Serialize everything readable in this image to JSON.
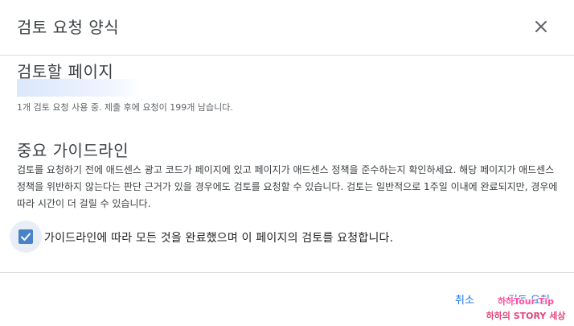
{
  "dialog": {
    "title": "검토 요청 양식",
    "close_icon": "close-icon"
  },
  "page_section": {
    "title": "검토할 페이지",
    "usage_text": "1개 검토 요청 사용 중. 제출 후에 요청이 199개 남습니다."
  },
  "guidelines": {
    "title": "중요 가이드라인",
    "body": "검토를 요청하기 전에 애드센스 광고 코드가 페이지에 있고 페이지가 애드센스 정책을 준수하는지 확인하세요. 해당 페이지가 애드센스 정책을 위반하지 않는다는 판단 근거가 있을 경우에도 검토를 요청할 수 있습니다. 검토는 일반적으로 1주일 이내에 완료되지만, 경우에 따라 시간이 더 걸릴 수 있습니다."
  },
  "confirm_checkbox": {
    "checked": true,
    "label": "가이드라인에 따라 모든 것을 완료했으며 이 페이지의 검토를 요청합니다."
  },
  "footer": {
    "cancel_label": "취소",
    "submit_label": "검토 요청"
  },
  "watermark": {
    "line1": "하하Tour Tip",
    "line2": "하하의 STORY 세상"
  },
  "colors": {
    "accent": "#1a73e8",
    "checkbox_fill": "#4a82c9",
    "divider": "#dadce0"
  }
}
